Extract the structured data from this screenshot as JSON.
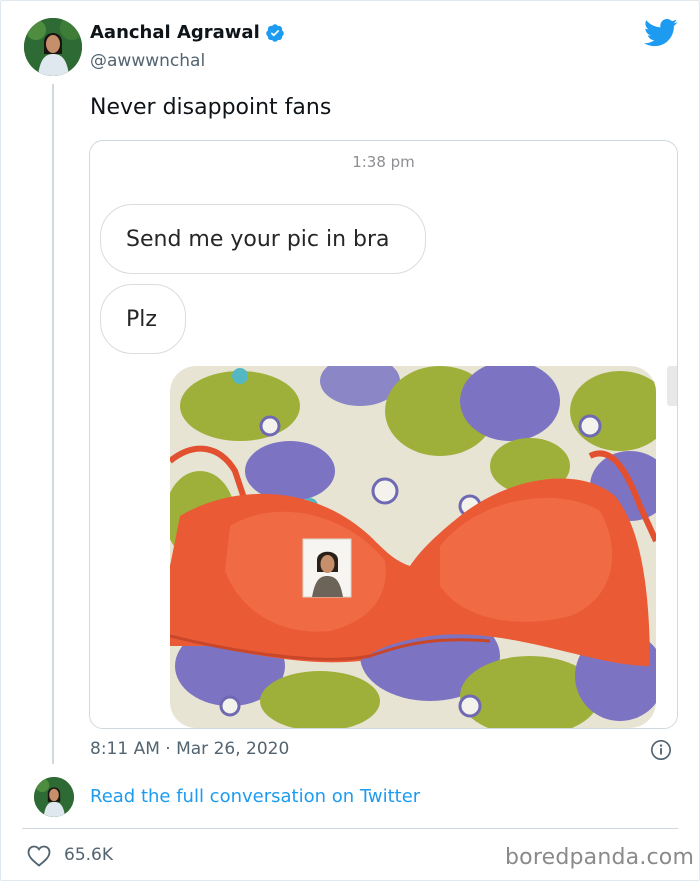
{
  "author": {
    "name": "Aanchal Agrawal",
    "handle": "@awwwnchal"
  },
  "tweet": {
    "text": "Never disappoint fans",
    "timestamp": "8:11 AM · Mar 26, 2020",
    "likes": "65.6K"
  },
  "chat": {
    "time": "1:38 pm",
    "messages": [
      "Send me your pic in bra",
      "Plz"
    ]
  },
  "footer": {
    "read_more": "Read the full conversation on Twitter",
    "watermark": "boredpanda.com"
  },
  "colors": {
    "brand": "#1d9bf0",
    "text": "#0f1419",
    "secondary": "#536471"
  },
  "icons": [
    "verified-badge-icon",
    "twitter-bird-icon",
    "info-icon",
    "heart-icon"
  ]
}
